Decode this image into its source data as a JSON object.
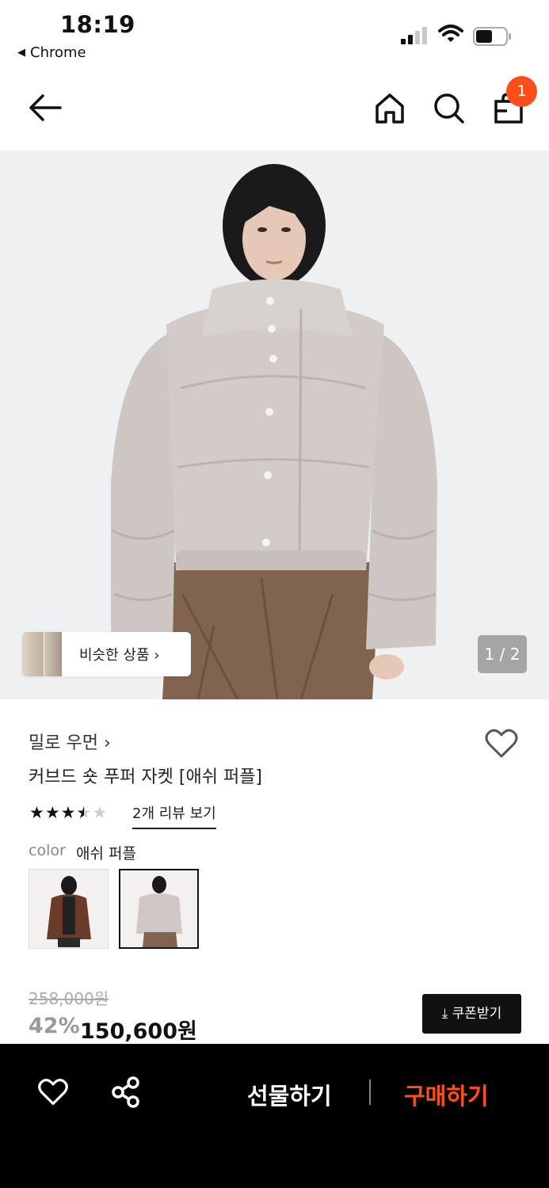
{
  "status_bar": {
    "time": "18:19",
    "back_app_label": "Chrome"
  },
  "header": {
    "cart_badge_count": "1"
  },
  "gallery": {
    "similar_label": "비슷한 상품 ›",
    "counter": "1 / 2"
  },
  "product": {
    "brand": "밀로 우먼 ›",
    "title": "커브드 숏 푸퍼 자켓 [애쉬 퍼플]",
    "rating": 3.5,
    "review_link": "2개 리뷰 보기",
    "color_label": "color",
    "color_value": "애쉬 퍼플",
    "swatches": [
      "brown",
      "ash-purple"
    ],
    "selected_swatch": 1,
    "original_price": "258,000원",
    "discount": "42%",
    "sale_price": "150,600원",
    "coupon_label": "⤓ 쿠폰받기"
  },
  "bottom_bar": {
    "gift_label": "선물하기",
    "buy_label": "구매하기"
  },
  "colors": {
    "accent": "#ff4e1a",
    "bottom_bar_bg": "#000000",
    "hero_bg": "#eef0f1"
  }
}
